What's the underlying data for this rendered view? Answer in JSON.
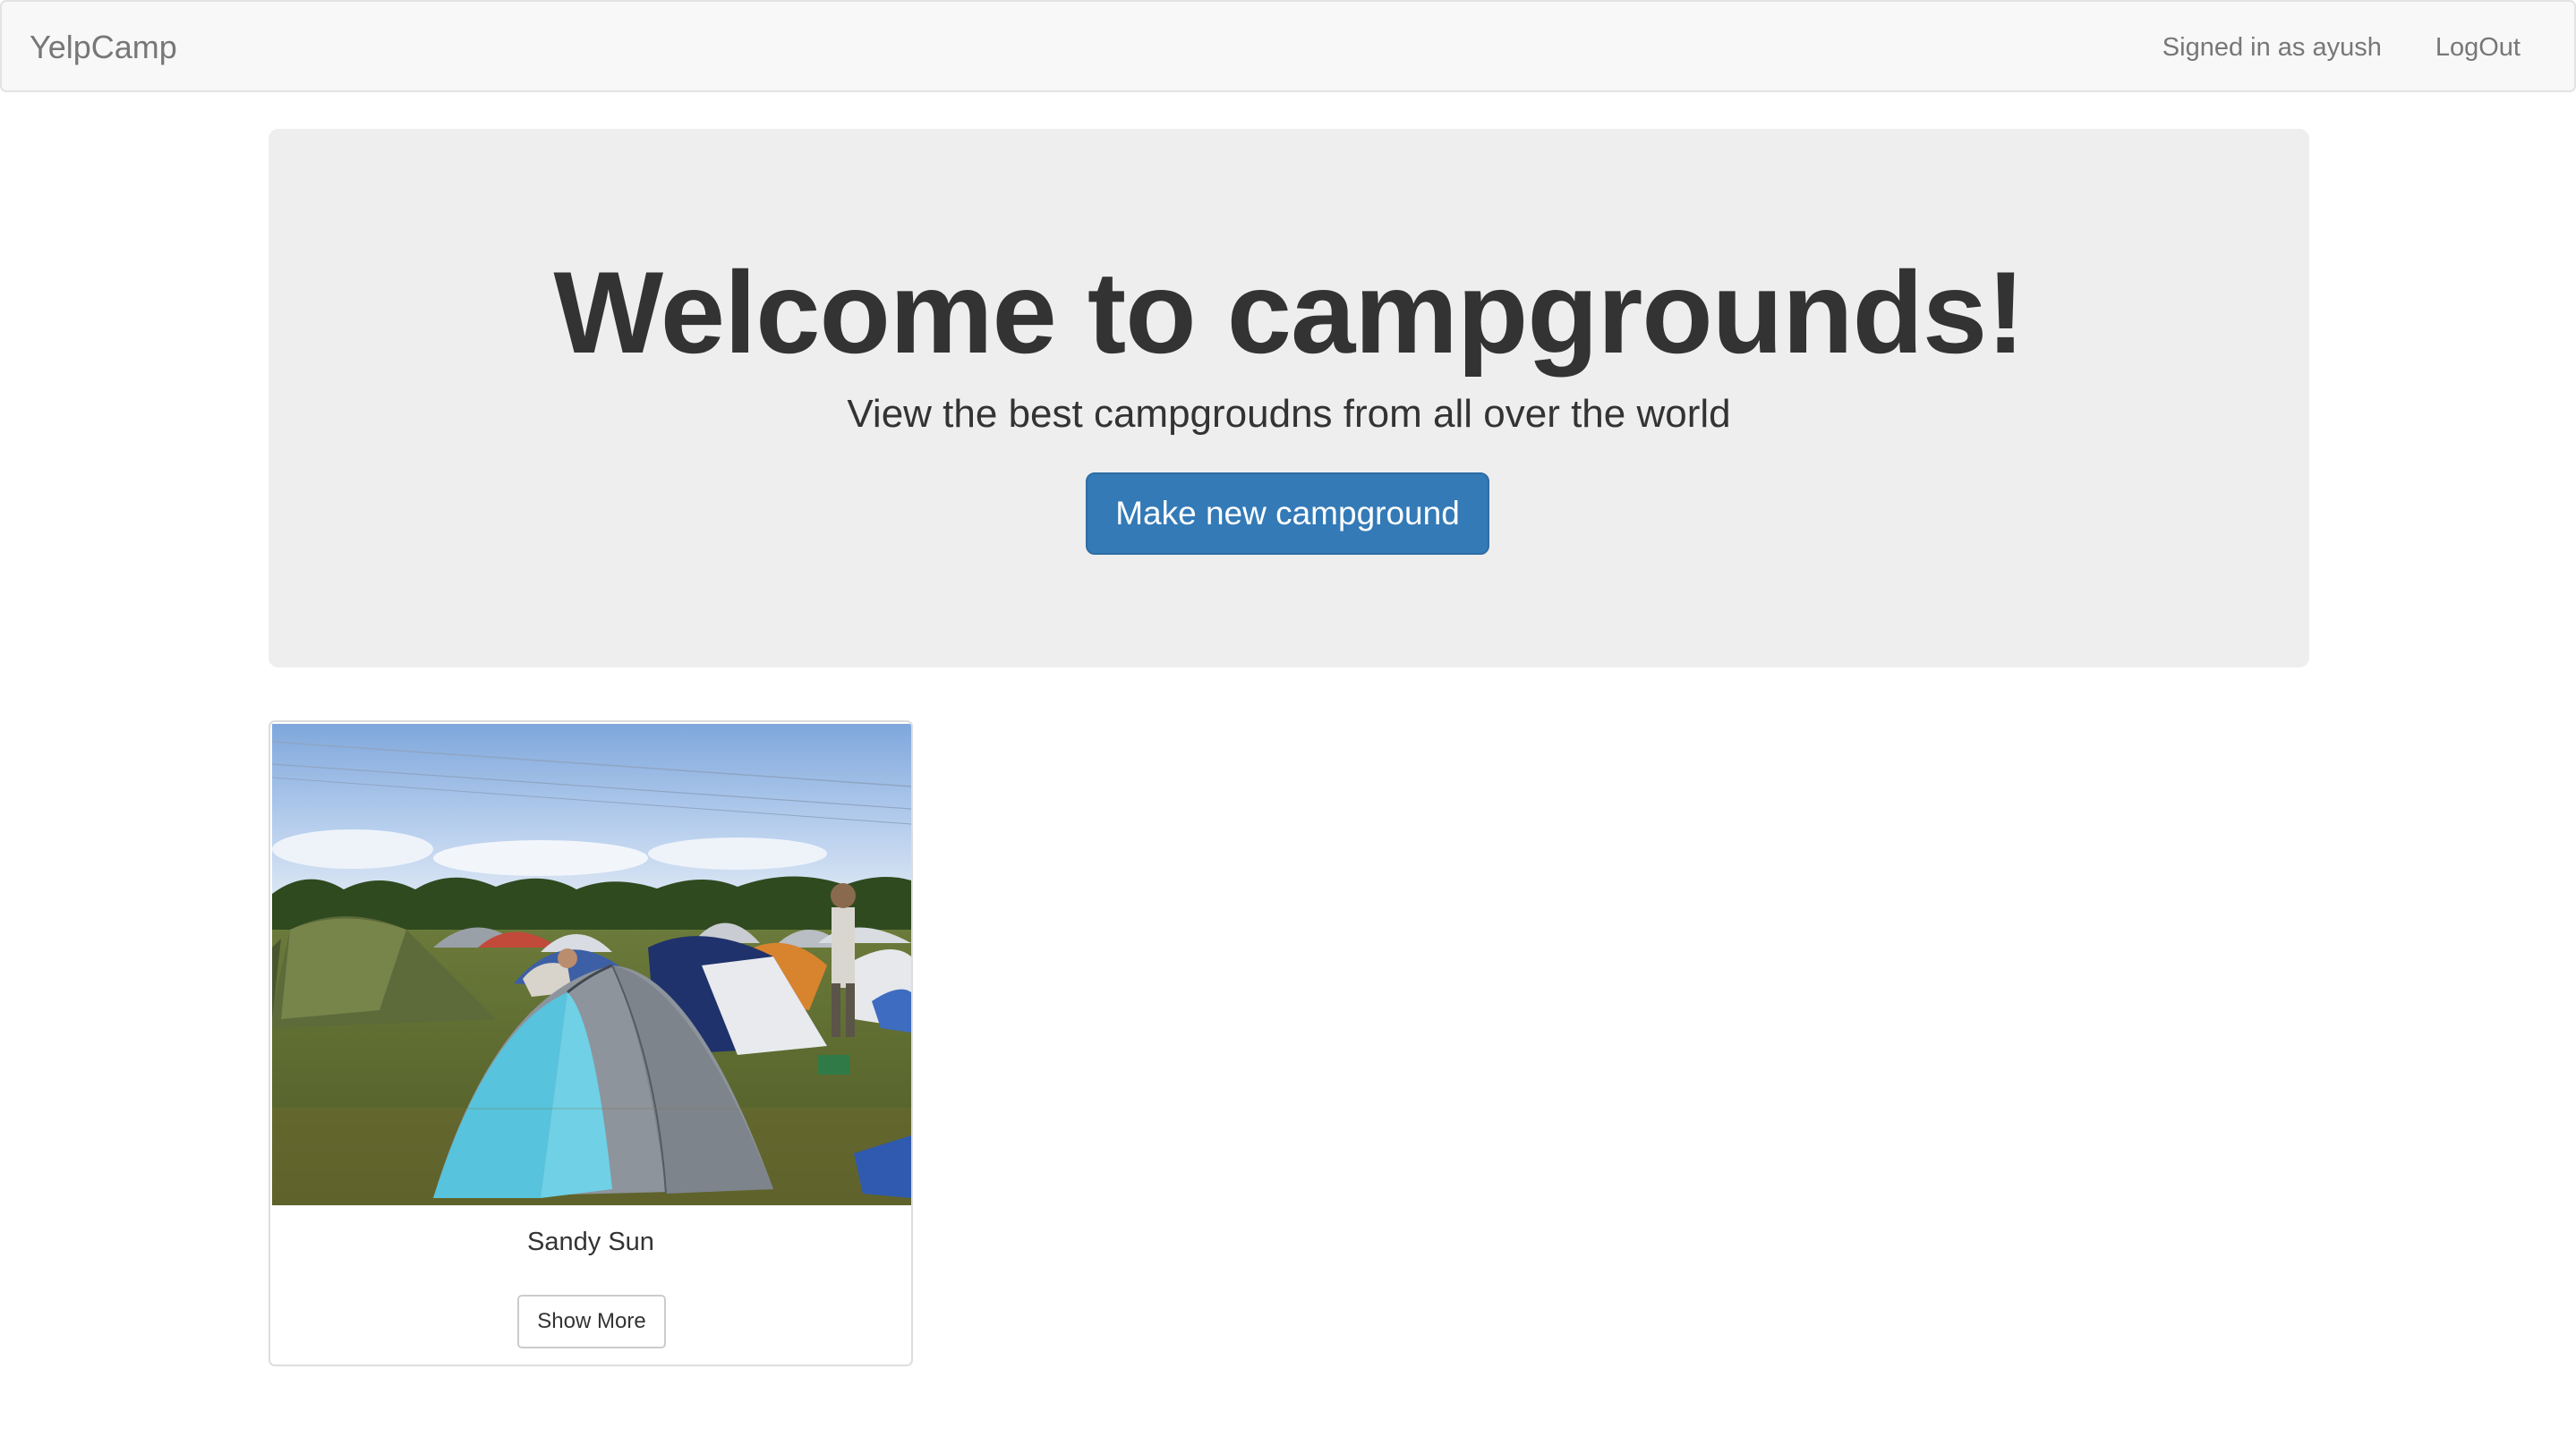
{
  "navbar": {
    "brand": "YelpCamp",
    "signed_in_text": "Signed in as ayush",
    "logout_label": "LogOut"
  },
  "jumbotron": {
    "title": "Welcome to campgrounds!",
    "subtitle": "View the best campgroudns from all over the world",
    "button_label": "Make new campground",
    "background_color": "#eeeeee",
    "button_color": "#337ab7"
  },
  "campgrounds": [
    {
      "name": "Sandy Sun",
      "image": "campground-tents-photo",
      "button_label": "Show More"
    }
  ]
}
